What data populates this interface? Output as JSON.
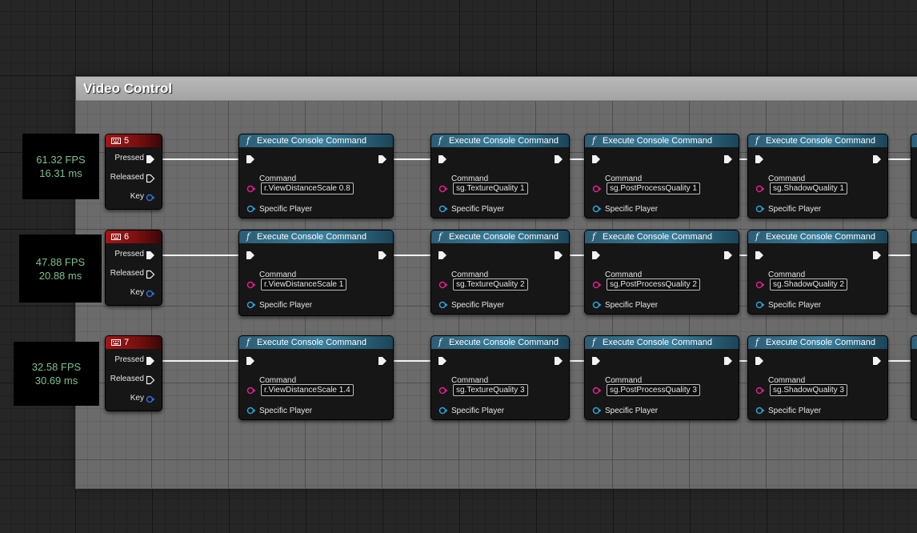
{
  "comment": {
    "title": "Video Control"
  },
  "rows": [
    {
      "fps": "61.32 FPS",
      "ms": "16.31 ms",
      "key": "5",
      "pins": {
        "pressed": "Pressed",
        "released": "Released",
        "key": "Key"
      },
      "commands": [
        {
          "title": "Execute Console Command",
          "command_label": "Command",
          "value": "r.ViewDistanceScale 0.8",
          "player_label": "Specific Player"
        },
        {
          "title": "Execute Console Command",
          "command_label": "Command",
          "value": "sg.TextureQuality 1",
          "player_label": "Specific Player"
        },
        {
          "title": "Execute Console Command",
          "command_label": "Command",
          "value": "sg.PostProcessQuality 1",
          "player_label": "Specific Player"
        },
        {
          "title": "Execute Console Command",
          "command_label": "Command",
          "value": "sg.ShadowQuality 1",
          "player_label": "Specific Player"
        }
      ]
    },
    {
      "fps": "47.88 FPS",
      "ms": "20.88 ms",
      "key": "6",
      "pins": {
        "pressed": "Pressed",
        "released": "Released",
        "key": "Key"
      },
      "commands": [
        {
          "title": "Execute Console Command",
          "command_label": "Command",
          "value": "r.ViewDistanceScale 1",
          "player_label": "Specific Player"
        },
        {
          "title": "Execute Console Command",
          "command_label": "Command",
          "value": "sg.TextureQuality 2",
          "player_label": "Specific Player"
        },
        {
          "title": "Execute Console Command",
          "command_label": "Command",
          "value": "sg.PostProcessQuality 2",
          "player_label": "Specific Player"
        },
        {
          "title": "Execute Console Command",
          "command_label": "Command",
          "value": "sg.ShadowQuality 2",
          "player_label": "Specific Player"
        }
      ]
    },
    {
      "fps": "32.58 FPS",
      "ms": "30.69 ms",
      "key": "7",
      "pins": {
        "pressed": "Pressed",
        "released": "Released",
        "key": "Key"
      },
      "commands": [
        {
          "title": "Execute Console Command",
          "command_label": "Command",
          "value": "r.ViewDistanceScale 1.4",
          "player_label": "Specific Player"
        },
        {
          "title": "Execute Console Command",
          "command_label": "Command",
          "value": "sg.TextureQuality 3",
          "player_label": "Specific Player"
        },
        {
          "title": "Execute Console Command",
          "command_label": "Command",
          "value": "sg.PostProcessQuality 3",
          "player_label": "Specific Player"
        },
        {
          "title": "Execute Console Command",
          "command_label": "Command",
          "value": "sg.ShadowQuality 3",
          "player_label": "Specific Player"
        }
      ]
    }
  ],
  "icons": {
    "key_event": "keyboard-icon",
    "function": "function-icon",
    "exec_pin": "exec-pin-icon",
    "string_pin": "string-pin-icon",
    "object_pin": "object-pin-icon",
    "key_pin": "key-pin-icon"
  },
  "colors": {
    "key_header": "#a11717",
    "function_header": "#3a7f9c",
    "string_pin": "#e0208f",
    "object_pin": "#2ea3d6",
    "fps_text": "#7fc08f"
  }
}
